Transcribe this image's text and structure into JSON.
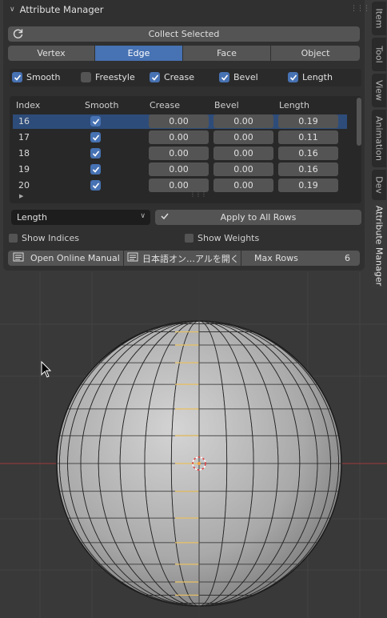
{
  "panel": {
    "title": "Attribute Manager",
    "collect_button": "Collect Selected",
    "modes": [
      "Vertex",
      "Edge",
      "Face",
      "Object"
    ],
    "active_mode": "Edge",
    "column_toggles": [
      {
        "label": "Smooth",
        "checked": true
      },
      {
        "label": "Freestyle",
        "checked": false
      },
      {
        "label": "Crease",
        "checked": true
      },
      {
        "label": "Bevel",
        "checked": true
      },
      {
        "label": "Length",
        "checked": true
      }
    ],
    "table": {
      "headers": [
        "Index",
        "Smooth",
        "Crease",
        "Bevel",
        "Length"
      ],
      "rows": [
        {
          "index": "16",
          "smooth": true,
          "crease": "0.00",
          "bevel": "0.00",
          "length": "0.19",
          "selected": true
        },
        {
          "index": "17",
          "smooth": true,
          "crease": "0.00",
          "bevel": "0.00",
          "length": "0.11",
          "selected": false
        },
        {
          "index": "18",
          "smooth": true,
          "crease": "0.00",
          "bevel": "0.00",
          "length": "0.16",
          "selected": false
        },
        {
          "index": "19",
          "smooth": true,
          "crease": "0.00",
          "bevel": "0.00",
          "length": "0.16",
          "selected": false
        },
        {
          "index": "20",
          "smooth": true,
          "crease": "0.00",
          "bevel": "0.00",
          "length": "0.19",
          "selected": false
        }
      ]
    },
    "attribute_dropdown": "Length",
    "apply_button": "Apply to All Rows",
    "show_indices": "Show Indices",
    "show_weights": "Show Weights",
    "manual_button": "Open Online Manual",
    "manual_jp_button": "日本語オン…アルを開く",
    "max_rows_label": "Max Rows",
    "max_rows_value": "6"
  },
  "side_tabs": [
    "Item",
    "Tool",
    "View",
    "Animation",
    "Dev",
    "Attribute Manager"
  ],
  "active_side_tab": "Attribute Manager",
  "colors": {
    "accent": "#4772b3",
    "panel": "#303030",
    "viewport": "#393939"
  }
}
